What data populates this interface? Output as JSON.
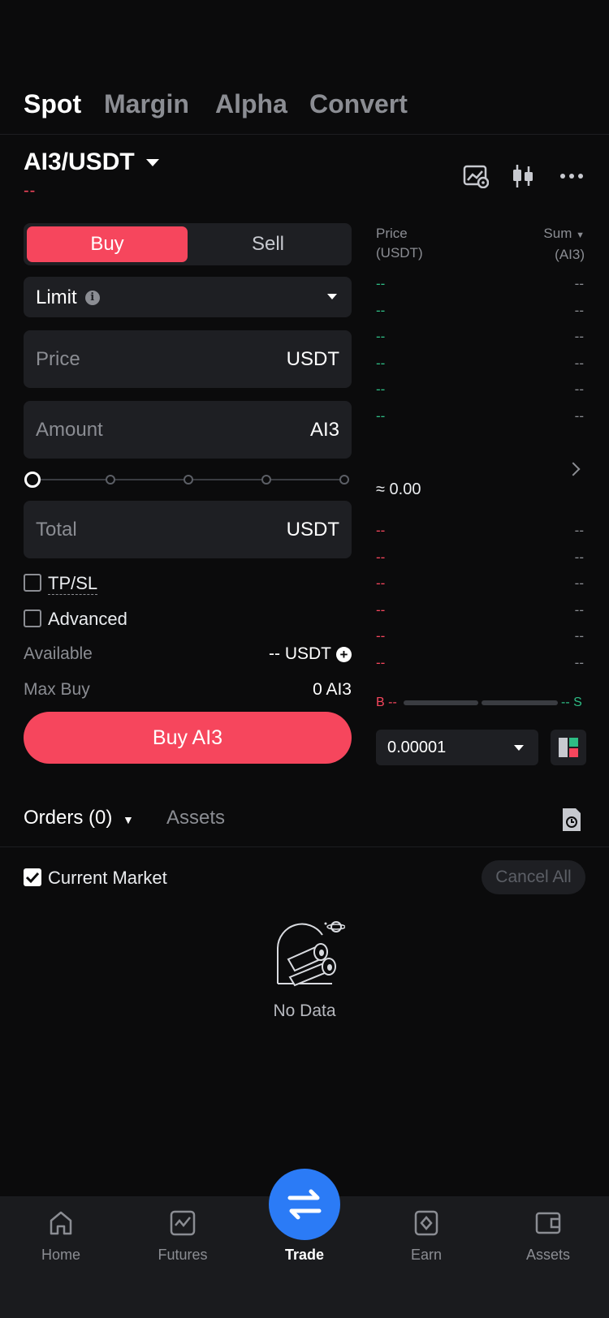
{
  "top_tabs": [
    {
      "label": "Spot",
      "active": true
    },
    {
      "label": "Margin",
      "active": false
    },
    {
      "label": "Alpha",
      "active": false
    },
    {
      "label": "Convert",
      "active": false
    }
  ],
  "header": {
    "pair": "AI3/USDT",
    "change": "--",
    "icons": [
      "chart-settings-icon",
      "candlestick-icon",
      "more-icon"
    ]
  },
  "trade_form": {
    "buy_label": "Buy",
    "sell_label": "Sell",
    "order_type": "Limit",
    "info_glyph": "i",
    "price": {
      "label": "Price",
      "unit": "USDT"
    },
    "amount": {
      "label": "Amount",
      "unit": "AI3"
    },
    "total": {
      "label": "Total",
      "unit": "USDT"
    },
    "slider_percent": 0,
    "tpsl_label": "TP/SL",
    "advanced_label": "Advanced",
    "available_label": "Available",
    "available_value": "-- USDT",
    "plus_glyph": "+",
    "max_buy_label": "Max Buy",
    "max_buy_value": "0 AI3",
    "submit_label": "Buy AI3"
  },
  "order_book": {
    "price_header_1": "Price",
    "price_header_2": "(USDT)",
    "sum_header_1": "Sum",
    "sum_header_2": "(AI3)",
    "bids_top": [
      {
        "price": "--",
        "sum": "--"
      },
      {
        "price": "--",
        "sum": "--"
      },
      {
        "price": "--",
        "sum": "--"
      },
      {
        "price": "--",
        "sum": "--"
      },
      {
        "price": "--",
        "sum": "--"
      },
      {
        "price": "--",
        "sum": "--"
      }
    ],
    "mid_price": "≈ 0.00",
    "asks": [
      {
        "price": "--",
        "sum": "--"
      },
      {
        "price": "--",
        "sum": "--"
      },
      {
        "price": "--",
        "sum": "--"
      },
      {
        "price": "--",
        "sum": "--"
      },
      {
        "price": "--",
        "sum": "--"
      },
      {
        "price": "--",
        "sum": "--"
      }
    ],
    "buy_ratio_label": "B --",
    "sell_ratio_label": "-- S",
    "precision": "0.00001"
  },
  "orders": {
    "tab_orders": "Orders (0)",
    "tab_assets": "Assets",
    "current_market_label": "Current Market",
    "cancel_all_label": "Cancel All",
    "empty_label": "No Data"
  },
  "bottom_nav": [
    {
      "label": "Home",
      "icon": "home-icon"
    },
    {
      "label": "Futures",
      "icon": "futures-icon"
    },
    {
      "label": "Trade",
      "icon": "trade-icon",
      "active": true
    },
    {
      "label": "Earn",
      "icon": "earn-icon"
    },
    {
      "label": "Assets",
      "icon": "wallet-icon"
    }
  ],
  "colors": {
    "buy": "#f6465d",
    "bid_green": "#2ebd85",
    "accent_blue": "#2b7bf6",
    "background": "#0b0b0c"
  }
}
